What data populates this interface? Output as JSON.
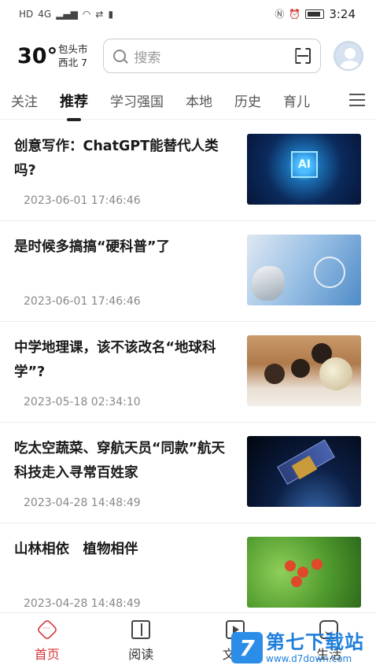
{
  "status_bar": {
    "left_icons": [
      "HD",
      "4G",
      "signal",
      "wifi",
      "sync",
      "battery-saver"
    ],
    "time": "3:24"
  },
  "header": {
    "temperature": "30°",
    "city": "包头市",
    "wind": "西北 7",
    "search_placeholder": "搜索"
  },
  "tabs": [
    {
      "label": "关注"
    },
    {
      "label": "推荐"
    },
    {
      "label": "学习强国"
    },
    {
      "label": "本地"
    },
    {
      "label": "历史"
    },
    {
      "label": "育儿"
    }
  ],
  "feed": [
    {
      "title": "创意写作：ChatGPT能替代人类吗?",
      "time": "2023-06-01 17:46:46",
      "thumb_label": "AI"
    },
    {
      "title": "是时候多搞搞“硬科普”了",
      "time": "2023-06-01 17:46:46"
    },
    {
      "title": "中学地理课，该不该改名“地球科学”?",
      "time": "2023-05-18 02:34:10"
    },
    {
      "title": "吃太空蔬菜、穿航天员“同款”航天科技走入寻常百姓家",
      "time": "2023-04-28 14:48:49"
    },
    {
      "title": "山林相依　植物相伴",
      "time": "2023-04-28 14:48:49"
    }
  ],
  "bottom_nav": [
    {
      "label": "首页"
    },
    {
      "label": "阅读"
    },
    {
      "label": "文化"
    },
    {
      "label": "生活"
    }
  ],
  "watermark": {
    "logo_char": "7",
    "name": "第七下载站",
    "url": "www.d7down.com"
  },
  "colors": {
    "accent": "#d6373a",
    "watermark_blue": "#1f7fdc"
  }
}
